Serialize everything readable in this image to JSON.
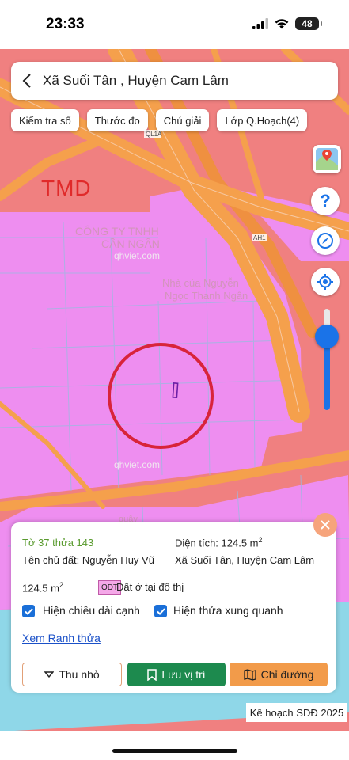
{
  "status": {
    "time": "23:33",
    "battery": "48"
  },
  "search": {
    "title": "Xã Suối Tân , Huyện Cam Lâm"
  },
  "chips": [
    "Kiểm tra sổ",
    "Thước đo",
    "Chú giải",
    "Lớp Q.Hoạch(4)"
  ],
  "map": {
    "zone_label": "TMD",
    "road_label_1": "QL1A",
    "road_label_2": "AH1",
    "watermark_company_1": "CÔNG TY TNHH",
    "watermark_company_2": "CẦN NGÂN",
    "watermark_site": "qhviet.com",
    "watermark_house_1": "Nhà của Nguyễn",
    "watermark_house_2": "Ngọc Thanh Ngân",
    "watermark_site_2": "qhviet.com",
    "watermark_bottom": "quậy"
  },
  "panel": {
    "parcel_id": "Tờ 37 thửa 143",
    "area_label": "Diện tích: 124.5 m",
    "area_sup": "2",
    "owner": "Tên chủ đất: Nguyễn Huy Vũ",
    "location": "Xã Suối Tân, Huyện Cam Lâm",
    "area_value": "124.5 m",
    "area_value_sup": "2",
    "land_code": "ODT",
    "land_type": "Đất ở tại đô thị",
    "checkbox_edges": "Hiện chiều dài cạnh",
    "checkbox_neighbors": "Hiện thửa xung quanh",
    "link_boundary": "Xem Ranh thửa",
    "btn_minimize": "Thu nhỏ",
    "btn_save": "Lưu vị trí",
    "btn_directions": "Chỉ đường"
  },
  "plan_label": "Kế hoạch SDĐ 2025",
  "colors": {
    "pink_zone": "#ee8ef0",
    "salmon_zone": "#f08080",
    "road": "#f5a04c",
    "water": "#8fd7e8",
    "accent_green": "#1d8a4e",
    "accent_orange": "#f29b4a"
  }
}
